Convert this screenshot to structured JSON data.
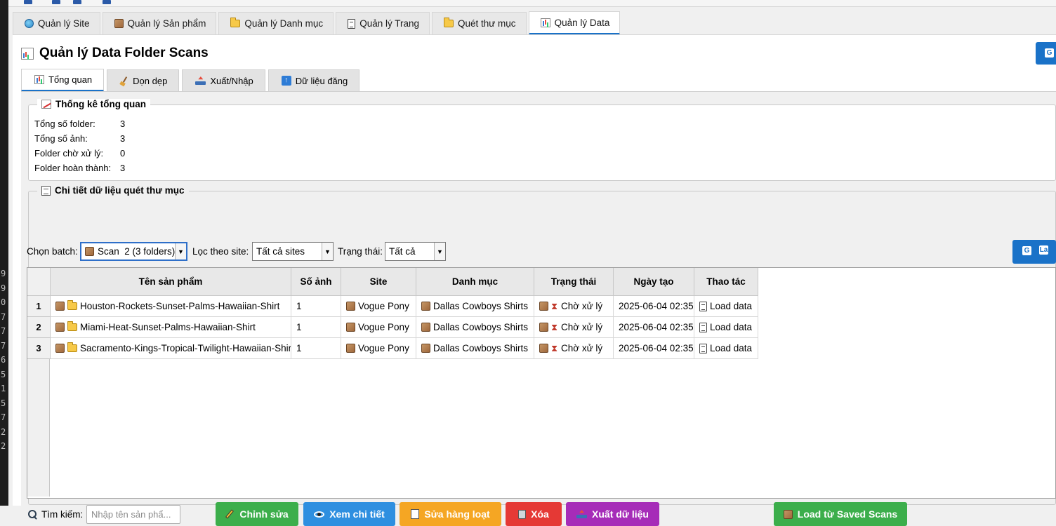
{
  "main_tabs": [
    {
      "label": "Quản lý Site",
      "icon": "globe-icon"
    },
    {
      "label": "Quản lý Sản phẩm",
      "icon": "box-icon"
    },
    {
      "label": "Quản lý Danh mục",
      "icon": "folder-icon"
    },
    {
      "label": "Quản lý Trang",
      "icon": "document-icon"
    },
    {
      "label": "Quét thư mục",
      "icon": "folder-icon"
    },
    {
      "label": "Quản lý Data",
      "icon": "chart-icon",
      "active": true
    }
  ],
  "page": {
    "title": "Quản lý Data Folder Scans",
    "title_icon": "chart-icon"
  },
  "sub_tabs": [
    {
      "label": "Tổng quan",
      "icon": "chart-icon",
      "active": true
    },
    {
      "label": "Dọn dẹp",
      "icon": "broom-icon"
    },
    {
      "label": "Xuất/Nhập",
      "icon": "tray-icon"
    },
    {
      "label": "Dữ liệu đăng",
      "icon": "up-arrow-icon"
    }
  ],
  "stats": {
    "legend": "Thống kê tổng quan",
    "items": [
      {
        "label": "Tổng số folder:",
        "value": "3"
      },
      {
        "label": "Tổng số ảnh:",
        "value": "3"
      },
      {
        "label": "Folder chờ xử lý:",
        "value": "0"
      },
      {
        "label": "Folder hoàn thành:",
        "value": "3"
      }
    ]
  },
  "details": {
    "legend": "Chi tiết dữ liệu quét thư mục",
    "batch_label": "Chọn batch:",
    "batch_value": "Scan  2 (3 folders)",
    "site_label": "Lọc theo site:",
    "site_value": "Tất cả sites",
    "status_label": "Trạng thái:",
    "status_value": "Tất cả",
    "refresh_label": "La"
  },
  "table": {
    "columns": [
      "Tên sản phẩm",
      "Số ảnh",
      "Site",
      "Danh mục",
      "Trạng thái",
      "Ngày tạo",
      "Thao tác"
    ],
    "rows": [
      {
        "num": "1",
        "name": "Houston-Rockets-Sunset-Palms-Hawaiian-Shirt",
        "images": "1",
        "site": "Vogue Pony",
        "category": "Dallas Cowboys Shirts",
        "status": "Chờ xử lý",
        "created": "2025-06-04 02:35",
        "action": "Load data"
      },
      {
        "num": "2",
        "name": "Miami-Heat-Sunset-Palms-Hawaiian-Shirt",
        "images": "1",
        "site": "Vogue Pony",
        "category": "Dallas Cowboys Shirts",
        "status": "Chờ xử lý",
        "created": "2025-06-04 02:35",
        "action": "Load data"
      },
      {
        "num": "3",
        "name": "Sacramento-Kings-Tropical-Twilight-Hawaiian-Shirt",
        "images": "1",
        "site": "Vogue Pony",
        "category": "Dallas Cowboys Shirts",
        "status": "Chờ xử lý",
        "created": "2025-06-04 02:35",
        "action": "Load data"
      }
    ]
  },
  "bottom": {
    "search_label": "Tìm kiếm:",
    "search_placeholder": "Nhập tên sản phẩ...",
    "buttons": [
      {
        "label": "Chỉnh sửa",
        "color": "#3cae4b",
        "icon": "pencil-icon"
      },
      {
        "label": "Xem chi tiết",
        "color": "#2e8fe0",
        "icon": "eye-icon"
      },
      {
        "label": "Sửa hàng loạt",
        "color": "#f5a623",
        "icon": "notepad-icon"
      },
      {
        "label": "Xóa",
        "color": "#e53935",
        "icon": "trash-icon"
      },
      {
        "label": "Xuất dữ liệu",
        "color": "#a62cb8",
        "icon": "tray-icon"
      },
      {
        "label": "Load từ Saved Scans",
        "color": "#3cae4b",
        "icon": "box-icon"
      }
    ]
  },
  "editor_gutter": [
    "9",
    "9",
    "0",
    "7",
    "7",
    "7",
    "6",
    "5",
    "1",
    "5",
    "7",
    "2",
    "2"
  ]
}
